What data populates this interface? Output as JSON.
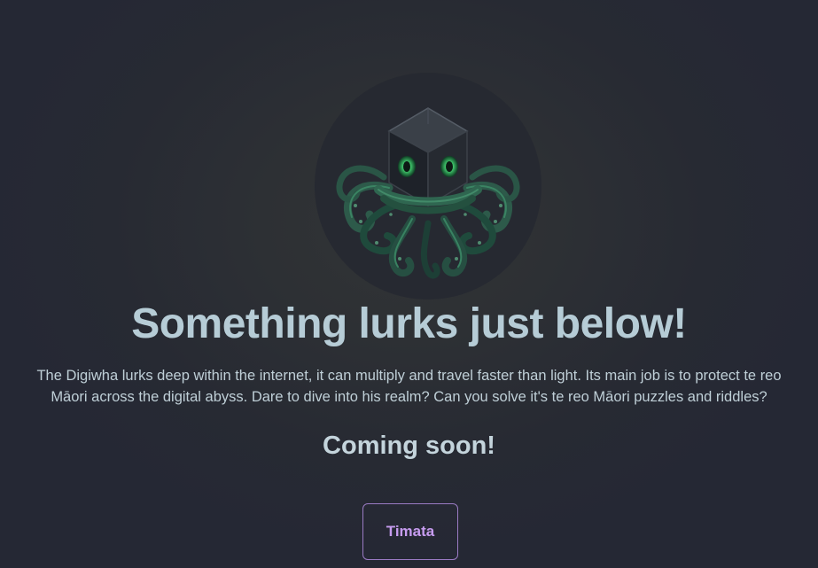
{
  "hero": {
    "logo_icon": "cube-octopus-icon",
    "title": "Something lurks just below!",
    "description": "The Digiwha lurks deep within the internet, it can multiply and travel faster than light. Its main job is to protect te reo Māori across the digital abyss. Dare to dive into his realm? Can you solve it's te reo Māori puzzles and riddles?",
    "status": "Coming soon!",
    "button_label": "Timata"
  },
  "colors": {
    "background": "#272a33",
    "title": "#b6ccd6",
    "button_accent": "#c79cf0",
    "button_border": "#9a7bc4",
    "eye_glow": "#4fd67a"
  }
}
